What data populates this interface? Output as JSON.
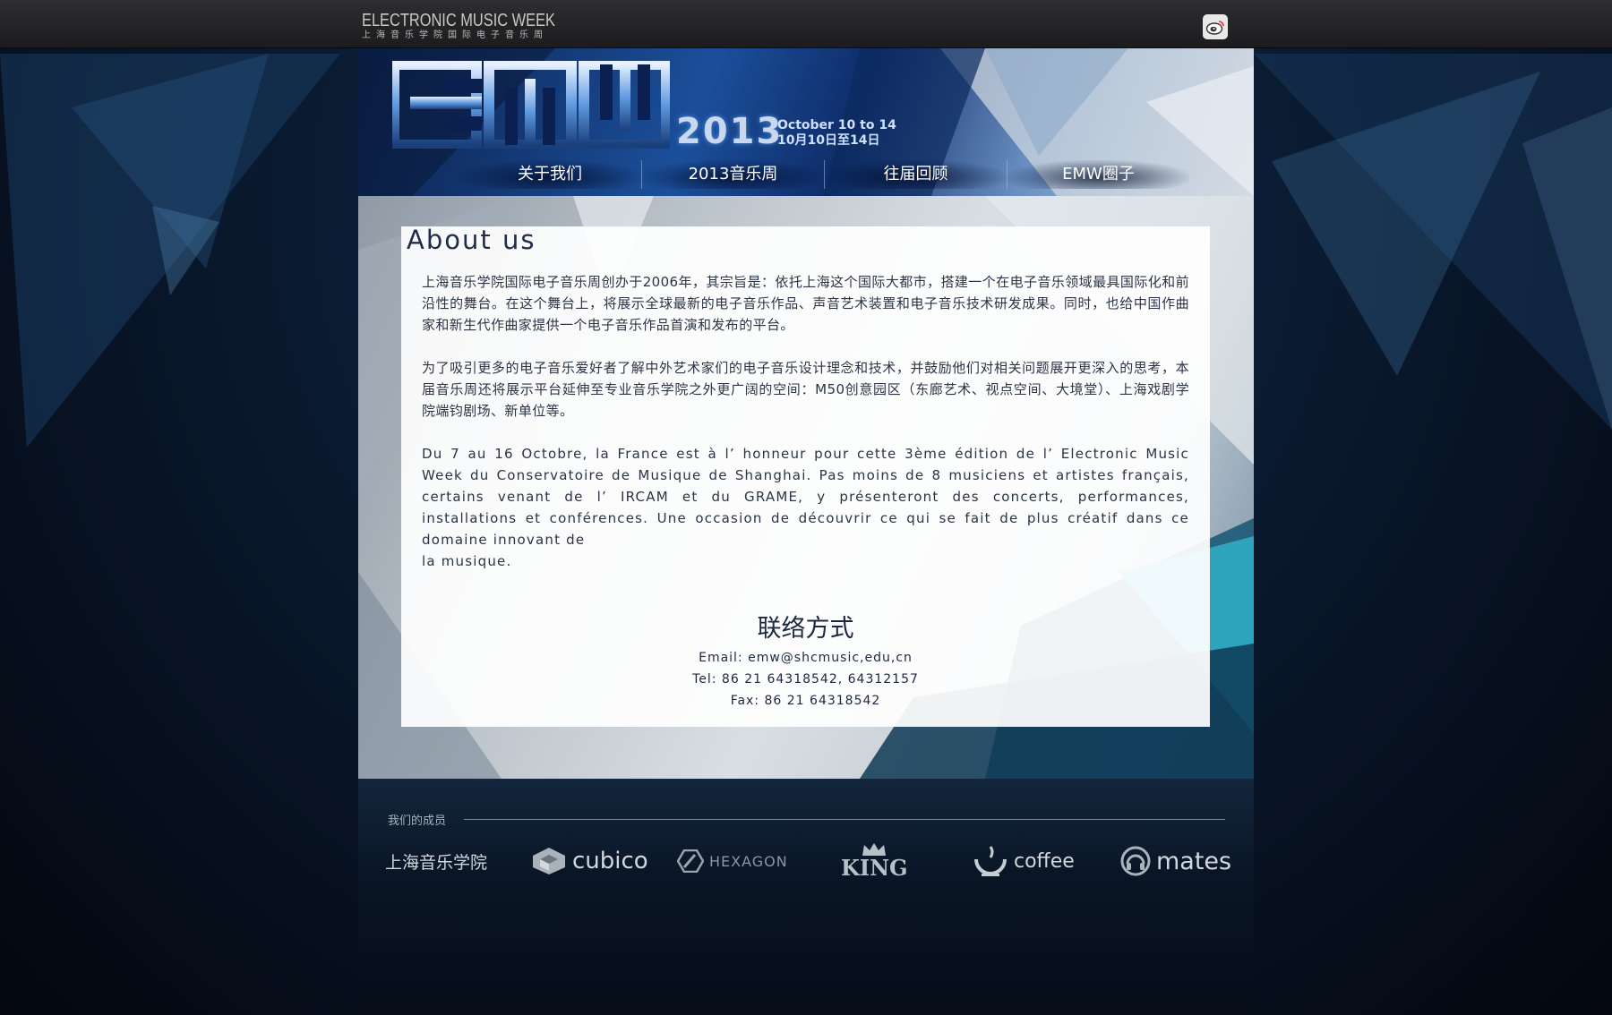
{
  "header": {
    "brand_en": "ELECTRONIC MUSIC WEEK",
    "brand_cn": "上海音乐学院国际电子音乐周",
    "weibo_icon": "weibo-icon"
  },
  "banner": {
    "logo_text": "EMW",
    "year": "2013",
    "dates_en": "October 10 to 14",
    "dates_cn": "10月10日至14日"
  },
  "nav": {
    "items": [
      {
        "label": "关于我们"
      },
      {
        "label": "2013音乐周"
      },
      {
        "label": "往届回顾"
      },
      {
        "label": "EMW圈子"
      }
    ]
  },
  "about": {
    "title": "About us",
    "p1": "上海音乐学院国际电子音乐周创办于2006年，其宗旨是：依托上海这个国际大都市，搭建一个在电子音乐领域最具国际化和前沿性的舞台。在这个舞台上，将展示全球最新的电子音乐作品、声音艺术装置和电子音乐技术研发成果。同时，也给中国作曲家和新生代作曲家提供一个电子音乐作品首演和发布的平台。",
    "p2": "为了吸引更多的电子音乐爱好者了解中外艺术家们的电子音乐设计理念和技术，并鼓励他们对相关问题展开更深入的思考，本届音乐周还将展示平台延伸至专业音乐学院之外更广阔的空间：M50创意园区（东廊艺术、视点空间、大境堂）、上海戏剧学院端钧剧场、新单位等。",
    "p3_line1": "Du 7 au 16 Octobre, la France est à l’ honneur pour cette 3ème édition de l’ Electronic Music Week du Conservatoire de Musique de Shanghai. Pas moins de 8 musiciens et artistes français, certains venant de l’ IRCAM et du GRAME, y présenteront des concerts, performances, installations et conférences. Une occasion de découvrir ce qui se fait de plus créatif dans ce domaine innovant de",
    "p3_line2": " la musique."
  },
  "contact": {
    "title": "联络方式",
    "email": "Email: emw@shcmusic,edu,cn",
    "tel": "Tel: 86 21 64318542, 64312157",
    "fax": "Fax: 86 21 64318542"
  },
  "footer": {
    "members_label": "我们的成员",
    "partners": [
      {
        "name": "上海音乐学院",
        "icon": "none"
      },
      {
        "name": "cubico",
        "icon": "cube-icon"
      },
      {
        "name": "HEXAGON",
        "icon": "hexagon-icon"
      },
      {
        "name": "KING",
        "icon": "crown-icon"
      },
      {
        "name": "coffee",
        "icon": "cup-icon"
      },
      {
        "name": "mates",
        "icon": "headphones-icon"
      }
    ]
  },
  "colors": {
    "topbar": "#252527",
    "banner_blue": "#1b4f9a",
    "panel_text": "#2a3445",
    "background": "#050a14"
  }
}
